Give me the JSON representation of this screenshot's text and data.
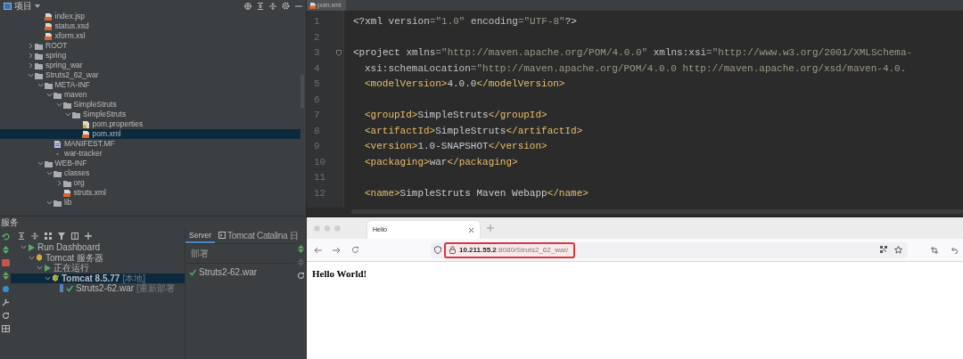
{
  "project_panel": {
    "title": "项目",
    "tree": [
      {
        "children": [
          {
            "label": "index.jsp",
            "kind": "xml",
            "selected": false
          },
          {
            "label": "status.xsd",
            "kind": "xml",
            "selected": false
          },
          {
            "label": "xform.xsl",
            "kind": "xml",
            "selected": false
          }
        ]
      },
      {
        "label": "ROOT",
        "kind": "folder",
        "expanded": false,
        "selected": false
      },
      {
        "label": "spring",
        "kind": "folder",
        "expanded": false,
        "selected": false
      },
      {
        "label": "spring_war",
        "kind": "folder",
        "expanded": false,
        "selected": false
      },
      {
        "label": "Struts2_62_war",
        "kind": "folder",
        "expanded": true,
        "selected": false,
        "children": [
          {
            "label": "META-INF",
            "kind": "folder",
            "expanded": true,
            "selected": false,
            "children": [
              {
                "label": "maven",
                "kind": "folder",
                "expanded": true,
                "selected": false,
                "children": [
                  {
                    "label": "SimpleStruts",
                    "kind": "folder",
                    "expanded": true,
                    "selected": false,
                    "children": [
                      {
                        "label": "SimpleStruts",
                        "kind": "folder",
                        "expanded": true,
                        "selected": false,
                        "children": [
                          {
                            "label": "pom.properties",
                            "kind": "properties",
                            "selected": false
                          },
                          {
                            "label": "pom.xml",
                            "kind": "xml",
                            "selected": true
                          }
                        ]
                      }
                    ]
                  }
                ]
              },
              {
                "label": "MANIFEST.MF",
                "kind": "manifest",
                "selected": false
              },
              {
                "label": "war-tracker",
                "kind": "plain",
                "selected": false
              }
            ]
          },
          {
            "label": "WEB-INF",
            "kind": "folder",
            "expanded": true,
            "selected": false,
            "children": [
              {
                "label": "classes",
                "kind": "folder",
                "expanded": true,
                "selected": false,
                "children": [
                  {
                    "label": "org",
                    "kind": "folder",
                    "expanded": false,
                    "selected": false
                  },
                  {
                    "label": "struts.xml",
                    "kind": "xml",
                    "selected": false
                  }
                ]
              },
              {
                "label": "lib",
                "kind": "folder",
                "expanded": true,
                "selected": false
              }
            ]
          }
        ]
      }
    ]
  },
  "services_panel": {
    "title": "服务",
    "tree": [
      {
        "label": "Run Dashboard",
        "kind": "dashboard",
        "expanded": true,
        "selected": false,
        "children": [
          {
            "label": "Tomcat 服务器",
            "kind": "server-group",
            "expanded": true,
            "selected": false,
            "children": [
              {
                "label": "正在运行",
                "kind": "running",
                "expanded": true,
                "selected": false,
                "children": [
                  {
                    "label": "Tomcat 8.5.77",
                    "note": "[本地]",
                    "kind": "server",
                    "expanded": true,
                    "selected": true,
                    "children": [
                      {
                        "label": "Struts2-62.war",
                        "note": "[重新部署",
                        "kind": "artifact",
                        "selected": false
                      }
                    ]
                  }
                ]
              }
            ]
          }
        ]
      }
    ],
    "tabs": [
      {
        "label": "Server",
        "selected": true
      },
      {
        "label": "Tomcat Catalina 日",
        "selected": false
      }
    ],
    "deploy_heading": "部署",
    "deployments": [
      {
        "label": "Struts2-62.war",
        "deployed": true
      }
    ]
  },
  "editor": {
    "tab": "pom.xml",
    "lines": [
      {
        "number": "1",
        "segments": [
          {
            "kind": "plain",
            "text": "<?xml "
          },
          {
            "kind": "attr",
            "text": "version"
          },
          {
            "kind": "punct",
            "text": "="
          },
          {
            "kind": "value",
            "text": "\"1.0\""
          },
          {
            "kind": "attr",
            "text": " encoding"
          },
          {
            "kind": "punct",
            "text": "="
          },
          {
            "kind": "value",
            "text": "\"UTF-8\""
          },
          {
            "kind": "plain",
            "text": "?>"
          }
        ]
      },
      {
        "number": "2"
      },
      {
        "number": "3",
        "fold": true,
        "segments": [
          {
            "kind": "plain",
            "text": "<project "
          },
          {
            "kind": "attr",
            "text": "xmlns"
          },
          {
            "kind": "punct",
            "text": "="
          },
          {
            "kind": "value",
            "text": "\"http://maven.apache.org/POM/4.0.0\""
          },
          {
            "kind": "attr",
            "text": " xmlns:xsi"
          },
          {
            "kind": "punct",
            "text": "="
          },
          {
            "kind": "value",
            "text": "\"http://www.w3.org/2001/XMLSchema-"
          }
        ]
      },
      {
        "number": "4",
        "indented": true,
        "segments": [
          {
            "kind": "attr",
            "text": "xsi:schemaLocation"
          },
          {
            "kind": "punct",
            "text": "="
          },
          {
            "kind": "value",
            "text": "\"http://maven.apache.org/POM/4.0.0 http://maven.apache.org/xsd/maven-4.0."
          }
        ]
      },
      {
        "number": "5",
        "indented": true,
        "segments": [
          {
            "kind": "tag",
            "text": "<modelVersion>"
          },
          {
            "kind": "plain",
            "text": "4.0.0"
          },
          {
            "kind": "tag",
            "text": "</modelVersion>"
          }
        ]
      },
      {
        "number": "6"
      },
      {
        "number": "7",
        "indented": true,
        "segments": [
          {
            "kind": "tag",
            "text": "<groupId>"
          },
          {
            "kind": "plain",
            "text": "SimpleStruts"
          },
          {
            "kind": "tag",
            "text": "</groupId>"
          }
        ]
      },
      {
        "number": "8",
        "indented": true,
        "segments": [
          {
            "kind": "tag",
            "text": "<artifactId>"
          },
          {
            "kind": "plain",
            "text": "SimpleStruts"
          },
          {
            "kind": "tag",
            "text": "</artifactId>"
          }
        ]
      },
      {
        "number": "9",
        "indented": true,
        "segments": [
          {
            "kind": "tag",
            "text": "<version>"
          },
          {
            "kind": "plain",
            "text": "1.0-SNAPSHOT"
          },
          {
            "kind": "tag",
            "text": "</version>"
          }
        ]
      },
      {
        "number": "10",
        "indented": true,
        "segments": [
          {
            "kind": "tag",
            "text": "<packaging>"
          },
          {
            "kind": "plain",
            "text": "war"
          },
          {
            "kind": "tag",
            "text": "</packaging>"
          }
        ]
      },
      {
        "number": "11"
      },
      {
        "number": "12",
        "indented": true,
        "segments": [
          {
            "kind": "tag",
            "text": "<name>"
          },
          {
            "kind": "plain",
            "text": "SimpleStruts Maven Webapp"
          },
          {
            "kind": "tag",
            "text": "</name>"
          }
        ]
      }
    ]
  },
  "browser": {
    "tabs": [
      {
        "title": "Hello",
        "selected": true
      }
    ],
    "address": "**10.211.55.2**:8080/Struts2_62_war/",
    "address_highlighted": true,
    "page_heading": "Hello World!"
  }
}
